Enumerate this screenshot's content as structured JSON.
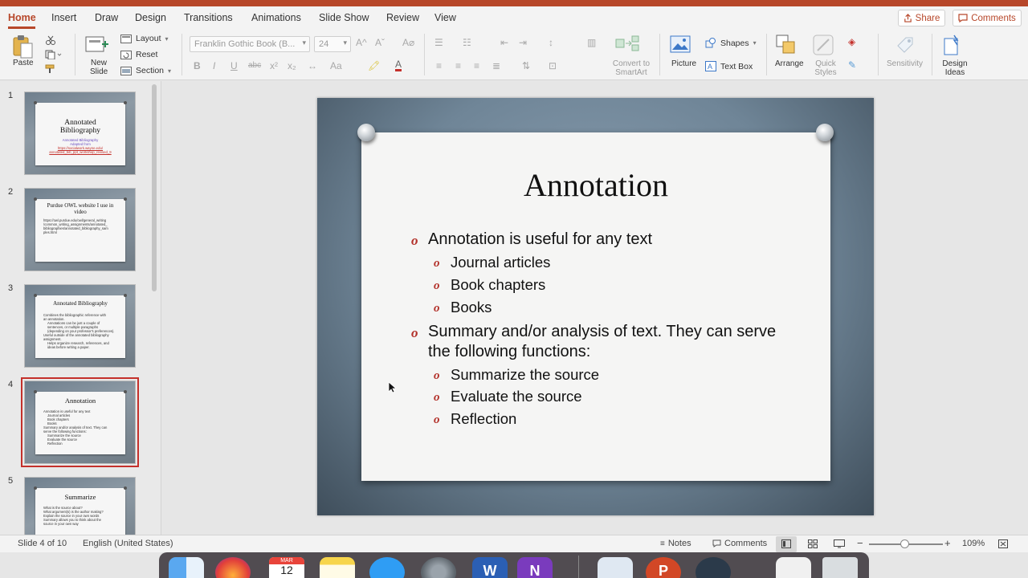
{
  "ribbon": {
    "tabs": [
      "Home",
      "Insert",
      "Draw",
      "Design",
      "Transitions",
      "Animations",
      "Slide Show",
      "Review",
      "View"
    ],
    "share_label": "Share",
    "comments_label": "Comments"
  },
  "toolbar": {
    "paste_label": "Paste",
    "new_slide_label": "New\nSlide",
    "layout_label": "Layout",
    "reset_label": "Reset",
    "section_label": "Section",
    "font_name": "Franklin Gothic Book (B...",
    "font_size": "24",
    "convert_smartart_label": "Convert to\nSmartArt",
    "picture_label": "Picture",
    "shapes_label": "Shapes",
    "textbox_label": "Text Box",
    "arrange_label": "Arrange",
    "quick_styles_label": "Quick\nStyles",
    "sensitivity_label": "Sensitivity",
    "design_ideas_label": "Design\nIdeas",
    "bold_glyph": "B",
    "italic_glyph": "I",
    "underline_glyph": "U",
    "strike_glyph": "abc",
    "superscript_glyph": "x²",
    "subscript_glyph": "x₂",
    "case_glyph": "Aa",
    "grow_glyph": "A^",
    "shrink_glyph": "Aˇ",
    "clear_glyph": "A⌀",
    "highlight_glyph": "🖍",
    "fontcolor_glyph": "A"
  },
  "thumbnails": [
    {
      "number": "1",
      "title": "Annotated\nBibliography",
      "sub": [
        "Annotated Bibliography",
        "Adapted from"
      ],
      "link": [
        "https://socialwork.wayne.edu/",
        "annotated_bib_ppt_workshop_revised_9"
      ],
      "lines": []
    },
    {
      "number": "2",
      "title": "Purdue OWL website I use in\nvideo",
      "sub": [],
      "link": [],
      "lines": [
        "https://owl.purdue.edu/owl/general_writing",
        "/common_writing_assignments/annotated_",
        "bibliographies/annotated_bibliography_sam",
        "ples.html"
      ]
    },
    {
      "number": "3",
      "title": "Annotated Bibliography",
      "sub": [],
      "link": [],
      "lines": [
        "Combines the bibliographic reference with",
        "an annotation.",
        "  Annotations can be just a couple of",
        "  sentences, or multiple paragraphs",
        "  (depending on your professor's preferences).",
        "Useful outside of the annotated bibliography",
        "assignment.",
        "  Helps organize research, references, and",
        "  ideas before writing a paper."
      ]
    },
    {
      "number": "4",
      "title": "Annotation",
      "sub": [],
      "link": [],
      "lines": [
        "Annotation is useful for any text",
        "  Journal articles",
        "  Book chapters",
        "  Books",
        "Summary and/or analysis of text. They can",
        "serve the following functions:",
        "  Summarize the source",
        "  Evaluate the source",
        "  Reflection"
      ]
    },
    {
      "number": "5",
      "title": "Summarize",
      "sub": [],
      "link": [],
      "lines": [
        "What is the source about?",
        "What argument(s) is the author making?",
        "Explain the source in your own words",
        "Summary allows you to think about the",
        "source in your own way"
      ]
    }
  ],
  "slide": {
    "title": "Annotation",
    "bullet_marker": "o",
    "bullets": [
      {
        "text": "Annotation is useful for any text",
        "sub": [
          "Journal articles",
          "Book chapters",
          "Books"
        ]
      },
      {
        "text": "Summary and/or analysis of text. They can serve the following functions:",
        "sub": [
          "Summarize the source",
          "Evaluate the source",
          "Reflection"
        ]
      }
    ]
  },
  "statusbar": {
    "slide_info": "Slide 4 of 10",
    "language": "English (United States)",
    "notes_label": "Notes",
    "comments_label": "Comments",
    "zoom": "109%",
    "zoom_minus": "−",
    "zoom_plus": "+"
  },
  "dock": {
    "calendar_month": "MAR",
    "calendar_day": "12"
  },
  "colors": {
    "accent": "#b7472a",
    "selected_outline": "#c4302b",
    "bullet_marker": "#b3322b"
  }
}
